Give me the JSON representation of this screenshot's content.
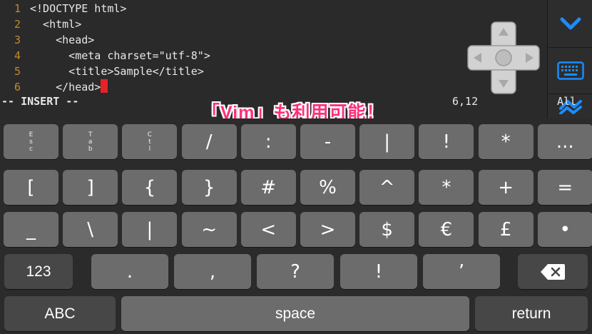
{
  "editor": {
    "lines": [
      {
        "num": "1",
        "text": "<!DOCTYPE html>"
      },
      {
        "num": "2",
        "text": "  <html>"
      },
      {
        "num": "3",
        "text": "    <head>"
      },
      {
        "num": "4",
        "text": "      <meta charset=\"utf-8\">"
      },
      {
        "num": "5",
        "text": "      <title>Sample</title>"
      },
      {
        "num": "6",
        "text": "    </head>"
      }
    ],
    "status_mode": "-- INSERT --",
    "cursor_position": "6,12",
    "scroll_indicator": "All",
    "cursor_color": "#e8202a"
  },
  "caption": "「Vim」も利用可能！",
  "side_panel": {
    "buttons": [
      "chevron-down-icon",
      "keyboard-icon",
      "swap-arrows-icon"
    ],
    "accent_color": "#1a8cff"
  },
  "keyboard": {
    "row1": [
      {
        "type": "stack",
        "chars": "E s c"
      },
      {
        "type": "stack",
        "chars": "T a b"
      },
      {
        "type": "stack",
        "chars": "C t l"
      },
      {
        "type": "key",
        "label": "/"
      },
      {
        "type": "key",
        "label": ":"
      },
      {
        "type": "key",
        "label": "-"
      },
      {
        "type": "key",
        "label": "|"
      },
      {
        "type": "key",
        "label": "!"
      },
      {
        "type": "key",
        "label": "*"
      },
      {
        "type": "key",
        "label": "..."
      }
    ],
    "row2": [
      "[",
      "]",
      "{",
      "}",
      "#",
      "%",
      "^",
      "*",
      "+",
      "="
    ],
    "row3": [
      "_",
      "\\",
      "|",
      "~",
      "<",
      ">",
      "$",
      "€",
      "£",
      "•"
    ],
    "row4": {
      "numbers_label": "123",
      "keys": [
        ".",
        ",",
        "?",
        "!",
        "’"
      ],
      "delete_icon": "backspace-icon"
    },
    "row5": {
      "abc_label": "ABC",
      "space_label": "space",
      "return_label": "return"
    }
  }
}
